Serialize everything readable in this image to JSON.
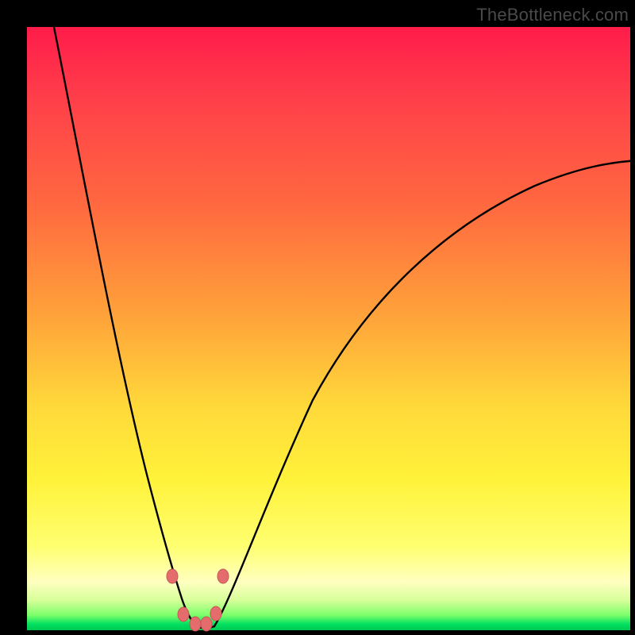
{
  "watermark": {
    "text": "TheBottleneck.com"
  },
  "colors": {
    "frame": "#000000",
    "curve_stroke": "#000000",
    "marker_fill": "#e46c6c",
    "marker_stroke": "#c75858",
    "gradient_stops": [
      "#ff1c4a",
      "#ff3f4a",
      "#ff6a3f",
      "#ffa33a",
      "#ffd93a",
      "#fff23a",
      "#ffff70",
      "#ffffc0",
      "#d8ff9a",
      "#7cff6a",
      "#00e060",
      "#00c850"
    ]
  },
  "chart_data": {
    "type": "line",
    "title": "",
    "xlabel": "",
    "ylabel": "",
    "xlim": [
      0,
      100
    ],
    "ylim": [
      0,
      100
    ],
    "grid": false,
    "legend": false,
    "annotations": [
      "TheBottleneck.com"
    ],
    "series": [
      {
        "name": "left-curve",
        "x": [
          4,
          6,
          8,
          10,
          12,
          14,
          16,
          18,
          20,
          21,
          22,
          23,
          24,
          25,
          26,
          27
        ],
        "y": [
          100,
          90,
          80,
          70,
          58,
          46,
          34,
          24,
          16,
          12,
          9,
          6,
          4,
          2.5,
          1.3,
          0.5
        ]
      },
      {
        "name": "right-curve",
        "x": [
          31,
          33,
          35,
          38,
          42,
          46,
          52,
          58,
          66,
          74,
          82,
          90,
          100
        ],
        "y": [
          0.5,
          3,
          7,
          13,
          22,
          31,
          42,
          51,
          60,
          66,
          71,
          75,
          78
        ]
      }
    ],
    "markers": [
      {
        "x": 23.5,
        "y": 9.0
      },
      {
        "x": 32.0,
        "y": 9.0
      },
      {
        "x": 25.3,
        "y": 2.5
      },
      {
        "x": 27.3,
        "y": 0.8
      },
      {
        "x": 29.2,
        "y": 1.2
      },
      {
        "x": 30.8,
        "y": 2.8
      }
    ]
  }
}
